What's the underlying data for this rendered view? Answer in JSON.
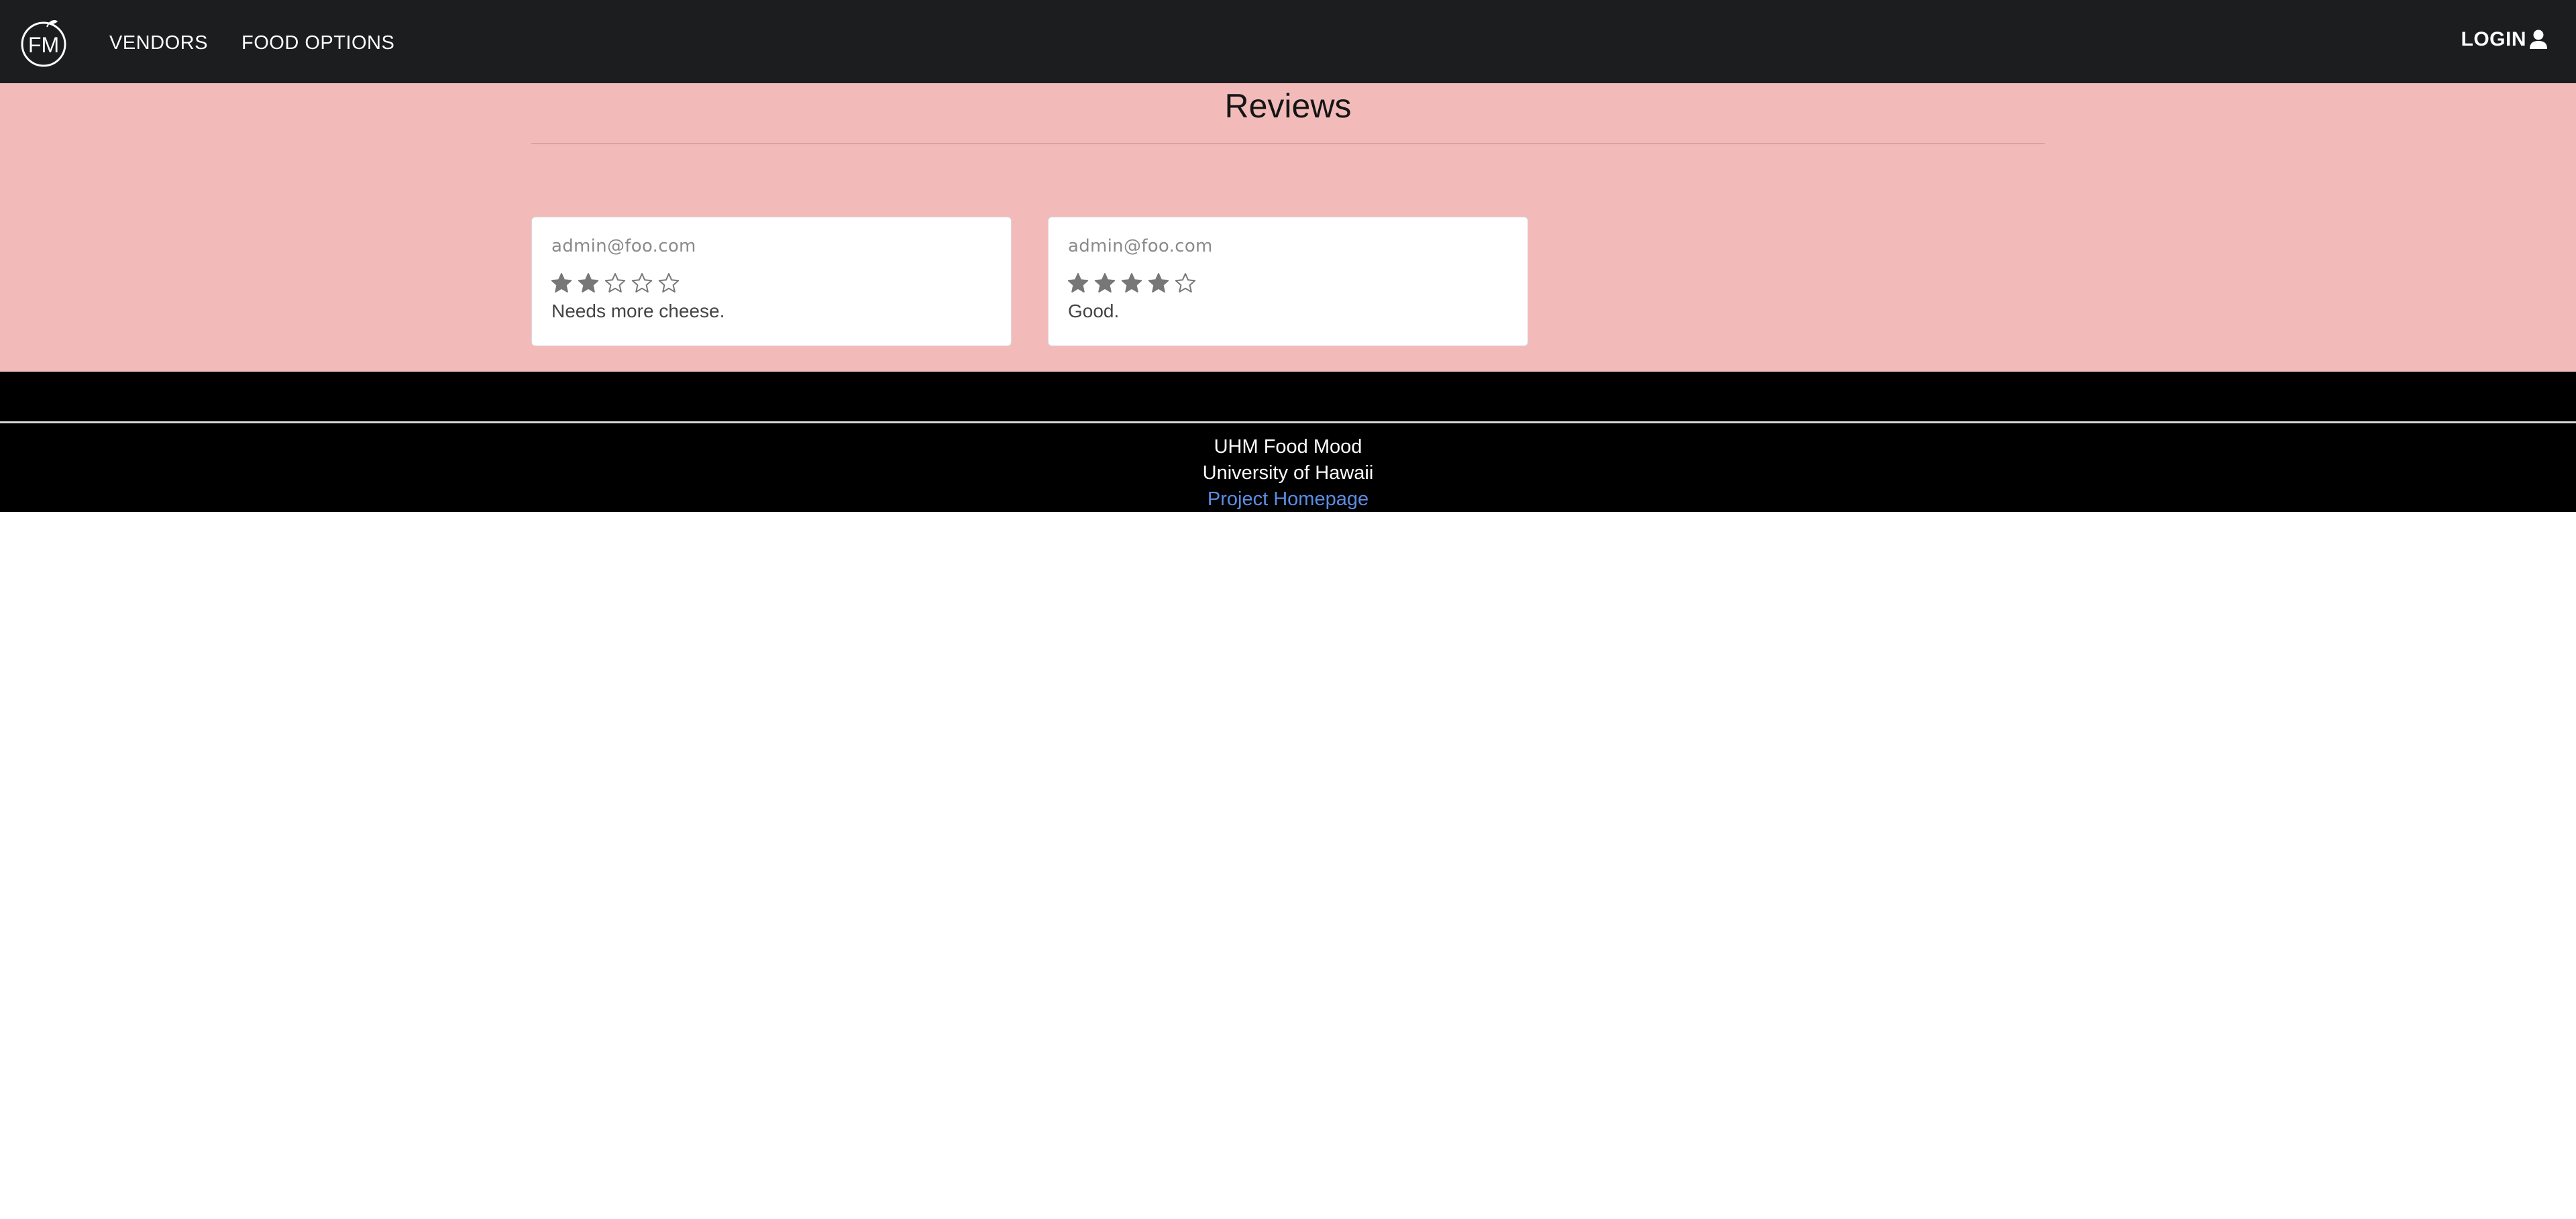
{
  "navbar": {
    "logo_text": "FM",
    "vendors_label": "VENDORS",
    "food_options_label": "FOOD OPTIONS",
    "login_label": "LOGIN"
  },
  "main": {
    "title": "Reviews",
    "reviews": [
      {
        "author": "admin@foo.com",
        "rating": 2,
        "max_rating": 5,
        "comment": "Needs more cheese."
      },
      {
        "author": "admin@foo.com",
        "rating": 4,
        "max_rating": 5,
        "comment": "Good."
      }
    ]
  },
  "footer": {
    "app_name": "UHM Food Mood",
    "university": "University of Hawaii",
    "homepage_link": "Project Homepage"
  },
  "colors": {
    "navbar_bg": "#1c1d1f",
    "main_bg": "#f2bbba",
    "footer_bg": "#000000",
    "link": "#5b8de5",
    "star": "#777777"
  }
}
